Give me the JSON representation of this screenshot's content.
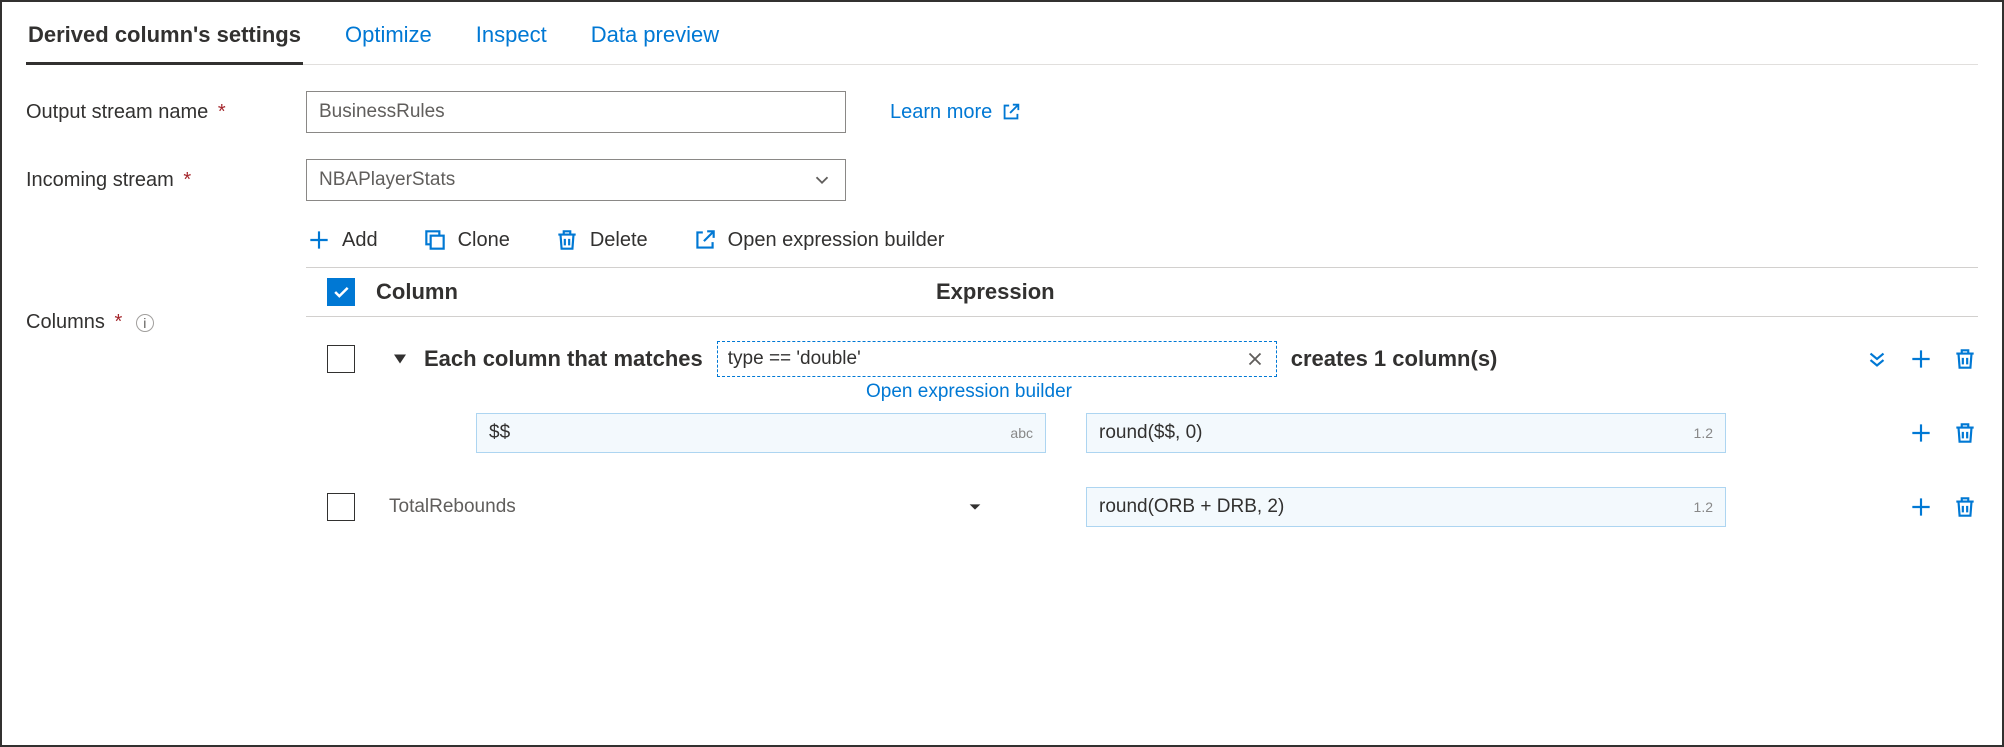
{
  "tabs": {
    "settings": "Derived column's settings",
    "optimize": "Optimize",
    "inspect": "Inspect",
    "preview": "Data preview"
  },
  "labels": {
    "output_stream": "Output stream name",
    "incoming_stream": "Incoming stream",
    "columns": "Columns",
    "learn_more": "Learn more"
  },
  "fields": {
    "output_stream_value": "BusinessRules",
    "incoming_stream_value": "NBAPlayerStats"
  },
  "toolbar": {
    "add": "Add",
    "clone": "Clone",
    "delete": "Delete",
    "open_builder": "Open expression builder"
  },
  "grid": {
    "header_column": "Column",
    "header_expression": "Expression",
    "pattern_prefix": "Each column that matches",
    "pattern_condition": "type == 'double'",
    "pattern_suffix": "creates 1 column(s)",
    "open_builder_link": "Open expression builder",
    "pattern_name_expr": "$$",
    "pattern_name_suffix": "abc",
    "pattern_value_expr": "round($$, 0)",
    "pattern_value_suffix": "1.2",
    "row2_column": "TotalRebounds",
    "row2_expression": "round(ORB + DRB, 2)",
    "row2_suffix": "1.2"
  }
}
